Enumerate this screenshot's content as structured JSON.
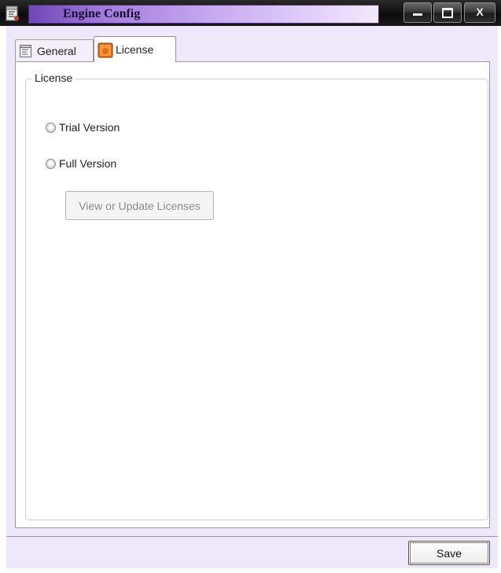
{
  "window": {
    "title": "Engine Config",
    "icons": {
      "app": "app-scroll-icon",
      "minimize": "minimize-icon",
      "maximize": "maximize-icon",
      "close": "close-icon"
    },
    "close_glyph": "X"
  },
  "tabs": [
    {
      "label": "General",
      "icon": "general-scroll-icon",
      "selected": false
    },
    {
      "label": "License",
      "icon": "license-icon",
      "selected": true
    }
  ],
  "license_group": {
    "legend": "License",
    "options": [
      {
        "label": "Trial Version",
        "checked": false
      },
      {
        "label": "Full Version",
        "checked": false
      }
    ],
    "update_button_label": "View or Update Licenses",
    "update_button_enabled": false
  },
  "footer": {
    "save_label": "Save"
  },
  "colors": {
    "title_accent": "#a37dde",
    "client_bg": "#efe7fa"
  }
}
